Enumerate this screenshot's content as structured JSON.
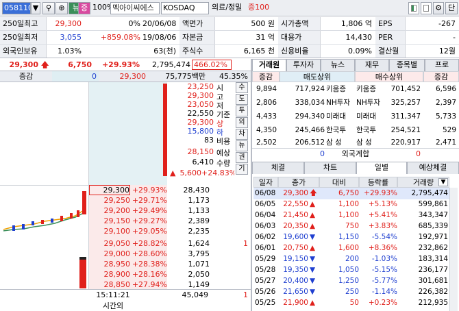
{
  "toolbar": {
    "code": "058110",
    "search_icon": "⚲",
    "magnify_icon": "⊕",
    "news_label": "뉴",
    "jeung_label": "증",
    "pct": "100%",
    "name": "멕아이씨에스",
    "market": "KOSDAQ",
    "sector": "의료/정밀",
    "margin": "증100",
    "dan_label": "단"
  },
  "info": [
    {
      "label": "250일최고",
      "val1": "29,300",
      "val2": "0%",
      "val3": "20/06/08",
      "l2": "액면가",
      "v2": "500 원",
      "l3": "시가총액",
      "v3": "1,806 억",
      "l4": "EPS",
      "v4": "-267"
    },
    {
      "label": "250일최저",
      "val1": "3,055",
      "val2": "+859.08%",
      "val3": "19/08/06",
      "l2": "자본금",
      "v2": "31 억",
      "l3": "대용가",
      "v3": "14,430",
      "l4": "PER",
      "v4": "-"
    },
    {
      "label": "외국인보유",
      "val1": "1.03%",
      "val2": "",
      "val3": "63(천)",
      "l2": "주식수",
      "v2": "6,165 천",
      "l3": "신용비율",
      "v3": "0.09%",
      "l4": "결산월",
      "v4": "12월"
    }
  ],
  "price": {
    "current": "29,300",
    "change": "6,750",
    "rate": "+29.93%",
    "volume": "2,795,474",
    "vol_rate": "466.02%"
  },
  "sub": {
    "label": "증감",
    "v1": "0",
    "v2": "29,300",
    "amount": "75,775백만",
    "ratio": "45.35%"
  },
  "summary": [
    {
      "v": "23,250",
      "k": "시"
    },
    {
      "v": "29,300",
      "k": "고"
    },
    {
      "v": "23,050",
      "k": "저"
    },
    {
      "v": "22,550",
      "k": "기준"
    },
    {
      "v": "29,300",
      "k": "상"
    },
    {
      "v": "15,800",
      "k": "하"
    },
    {
      "v": "83",
      "k": "비용"
    },
    {
      "v": "28,150",
      "k": "예상"
    },
    {
      "v": "6,410",
      "k": "수량"
    }
  ],
  "expected_change": {
    "v": "5,600",
    "rate": "+24.83%"
  },
  "side_buttons": [
    "수",
    "도",
    "투",
    "외",
    "차",
    "뉴",
    "권",
    "기"
  ],
  "bids": [
    {
      "price": "29,300",
      "rate": "+29.93%",
      "qty": "28,430"
    },
    {
      "price": "29,250",
      "rate": "+29.71%",
      "qty": "1,173"
    },
    {
      "price": "29,200",
      "rate": "+29.49%",
      "qty": "1,133"
    },
    {
      "price": "29,150",
      "rate": "+29.27%",
      "qty": "2,389"
    },
    {
      "price": "29,100",
      "rate": "+29.05%",
      "qty": "2,235"
    },
    {
      "price": "29,050",
      "rate": "+28.82%",
      "qty": "1,624",
      "extra": "1"
    },
    {
      "price": "29,000",
      "rate": "+28.60%",
      "qty": "3,795"
    },
    {
      "price": "28,950",
      "rate": "+28.38%",
      "qty": "1,071"
    },
    {
      "price": "28,900",
      "rate": "+28.16%",
      "qty": "2,050"
    },
    {
      "price": "28,850",
      "rate": "+27.94%",
      "qty": "1,149"
    }
  ],
  "footer": {
    "time": "15:11:21",
    "total": "45,049",
    "extra": "1",
    "after_label": "시간외"
  },
  "right_tabs": [
    "거래원",
    "투자자",
    "뉴스",
    "재무",
    "종목별",
    "프로"
  ],
  "broker_hdr": [
    "증감",
    "매도상위",
    "매수상위",
    "증감"
  ],
  "brokers": [
    {
      "d1": "9,894",
      "s": "717,924",
      "sn": "키움증",
      "bn": "키움증",
      "b": "701,452",
      "d2": "6,596"
    },
    {
      "d1": "2,806",
      "s": "338,034",
      "sn": "NH투자",
      "bn": "NH투자",
      "b": "325,257",
      "d2": "2,397"
    },
    {
      "d1": "4,433",
      "s": "294,340",
      "sn": "미래대",
      "bn": "미래대",
      "b": "311,347",
      "d2": "5,733"
    },
    {
      "d1": "4,350",
      "s": "245,466",
      "sn": "한국투",
      "bn": "한국투",
      "b": "254,521",
      "d2": "529"
    },
    {
      "d1": "2,502",
      "s": "206,512",
      "sn": "삼 성",
      "bn": "삼 성",
      "b": "220,917",
      "d2": "2,471"
    }
  ],
  "foreign": {
    "v1": "0",
    "label": "외국계합",
    "v2": "0"
  },
  "lower_tabs": [
    "체결",
    "차트",
    "일별",
    "예상체결"
  ],
  "daily_hdr": [
    "일자",
    "종가",
    "대비",
    "등락률",
    "거래량"
  ],
  "daily": [
    {
      "d": "06/08",
      "c": "29,300",
      "ch": "6,750",
      "r": "+29.93%",
      "v": "2,795,474",
      "dir": "limit"
    },
    {
      "d": "06/05",
      "c": "22,550",
      "ch": "1,100",
      "r": "+5.13%",
      "v": "599,861",
      "dir": "up"
    },
    {
      "d": "06/04",
      "c": "21,450",
      "ch": "1,100",
      "r": "+5.41%",
      "v": "343,347",
      "dir": "up"
    },
    {
      "d": "06/03",
      "c": "20,350",
      "ch": "750",
      "r": "+3.83%",
      "v": "685,339",
      "dir": "up"
    },
    {
      "d": "06/02",
      "c": "19,600",
      "ch": "1,150",
      "r": "-5.54%",
      "v": "192,971",
      "dir": "down"
    },
    {
      "d": "06/01",
      "c": "20,750",
      "ch": "1,600",
      "r": "+8.36%",
      "v": "232,862",
      "dir": "up"
    },
    {
      "d": "05/29",
      "c": "19,150",
      "ch": "200",
      "r": "-1.03%",
      "v": "183,314",
      "dir": "down"
    },
    {
      "d": "05/28",
      "c": "19,350",
      "ch": "1,050",
      "r": "-5.15%",
      "v": "236,177",
      "dir": "down"
    },
    {
      "d": "05/27",
      "c": "20,400",
      "ch": "1,250",
      "r": "-5.77%",
      "v": "301,681",
      "dir": "down"
    },
    {
      "d": "05/26",
      "c": "21,650",
      "ch": "250",
      "r": "-1.14%",
      "v": "226,382",
      "dir": "down"
    },
    {
      "d": "05/25",
      "c": "21,900",
      "ch": "50",
      "r": "+0.23%",
      "v": "212,935",
      "dir": "up"
    }
  ],
  "colors": {
    "up": "#e0201b",
    "down": "#1f3fd0",
    "ask_bg": "#e4f1f4",
    "bid_bg": "#fbeaea"
  }
}
